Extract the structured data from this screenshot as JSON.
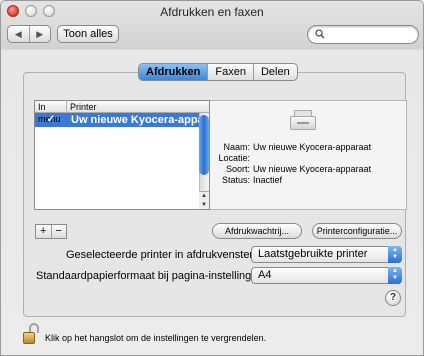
{
  "window": {
    "title": "Afdrukken en faxen"
  },
  "toolbar": {
    "show_all_label": "Toon alles",
    "search_placeholder": "",
    "back_glyph": "◀",
    "forward_glyph": "▶"
  },
  "tabs": [
    {
      "label": "Afdrukken",
      "active": true
    },
    {
      "label": "Faxen",
      "active": false
    },
    {
      "label": "Delen",
      "active": false
    }
  ],
  "printer_list": {
    "columns": [
      "In menu",
      "Printer"
    ],
    "rows": [
      {
        "in_menu": true,
        "check_glyph": "✓",
        "name": "Uw nieuwe Kyocera-apparaat",
        "selected": true
      }
    ]
  },
  "printer_info": {
    "name_label": "Naam:",
    "name_value": "Uw nieuwe Kyocera-apparaat",
    "location_label": "Locatie:",
    "location_value": "",
    "kind_label": "Soort:",
    "kind_value": "Uw nieuwe Kyocera-apparaat",
    "status_label": "Status:",
    "status_value": "Inactief"
  },
  "buttons": {
    "add": "+",
    "remove": "−",
    "print_queue": "Afdrukwachtrij...",
    "printer_config": "Printerconfiguratie..."
  },
  "form": {
    "default_printer_label": "Geselecteerde printer in afdrukvenster:",
    "default_printer_value": "Laatstgebruikte printer",
    "paper_size_label": "Standaardpapierformaat bij pagina-instelling:",
    "paper_size_value": "A4"
  },
  "help_glyph": "?",
  "lock_text": "Klik op het hangslot om de instellingen te vergrendelen.",
  "colors": {
    "selection": "#3a7ad6",
    "accent_blue": "#2a70d0"
  }
}
